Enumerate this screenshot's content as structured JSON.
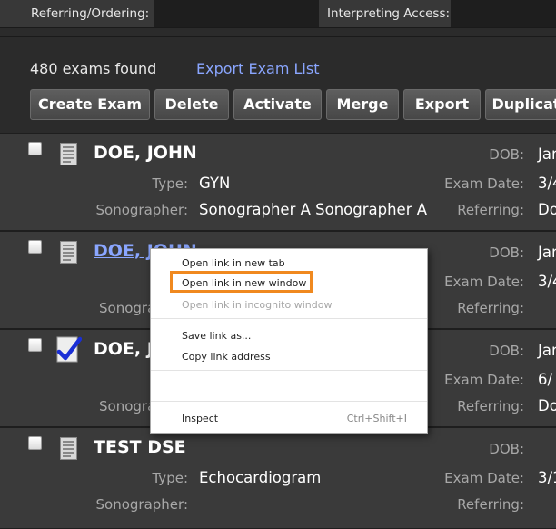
{
  "filters": {
    "referring_label": "Referring/Ordering:",
    "interpreting_label": "Interpreting Access:"
  },
  "summary": {
    "count_text": "480 exams found",
    "export_link": "Export Exam List"
  },
  "toolbar": {
    "create": "Create Exam",
    "delete": "Delete",
    "activate": "Activate",
    "merge": "Merge",
    "export": "Export",
    "duplicate": "Duplicat"
  },
  "labels": {
    "type": "Type:",
    "sonographer": "Sonographer:",
    "dob": "DOB:",
    "exam_date": "Exam Date:",
    "referring": "Referring:"
  },
  "exams": [
    {
      "name": "DOE, JOHN",
      "type": "GYN",
      "sonographer": "Sonographer A Sonographer A",
      "dob": "Jan",
      "exam_date": "3/4",
      "referring": "Do"
    },
    {
      "name": "DOE, JOHN",
      "type": "",
      "sonographer": "",
      "dob": "Jan",
      "exam_date": "3/4",
      "referring": ""
    },
    {
      "name": "DOE, J",
      "type": "",
      "sonographer": "",
      "dob": "Jan",
      "exam_date": "6/",
      "referring": "Do"
    },
    {
      "name": "TEST DSE",
      "type": "Echocardiogram",
      "sonographer": "",
      "dob": "",
      "exam_date": "3/1",
      "referring": ""
    }
  ],
  "truncated_labels": {
    "sonographer_row2": "Sonogra",
    "sonographer_row3": "Sonogra"
  },
  "context_menu": {
    "open_new_tab": "Open link in new tab",
    "open_new_window": "Open link in new window",
    "open_incognito": "Open link in incognito window",
    "save_link": "Save link as...",
    "copy_link": "Copy link address",
    "inspect": "Inspect",
    "inspect_shortcut": "Ctrl+Shift+I"
  },
  "colors": {
    "background": "#2b2b2b",
    "row": "#3a3a3a",
    "link": "#8aa6ff",
    "highlight": "#f0891f",
    "check": "#1b2fd6"
  }
}
